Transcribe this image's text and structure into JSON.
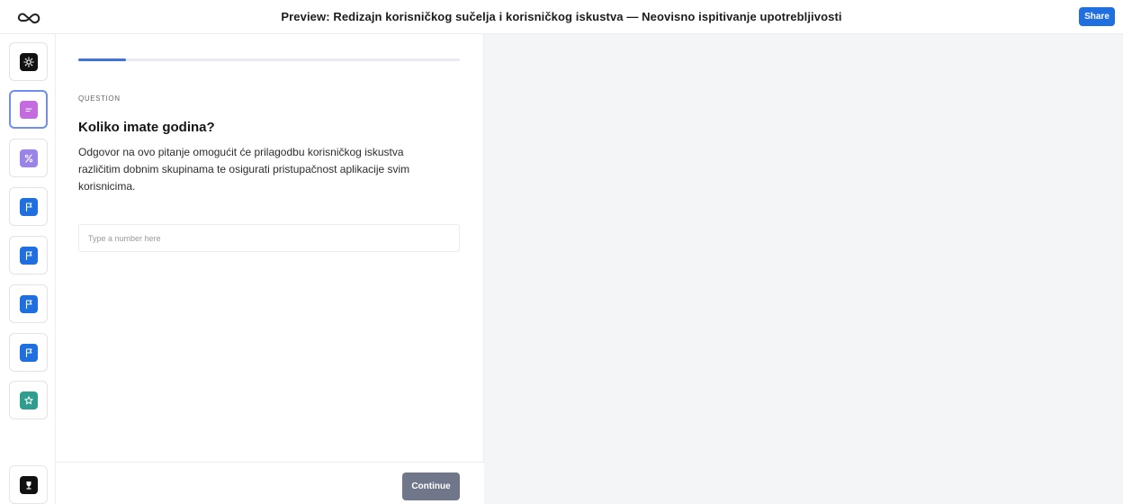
{
  "header": {
    "title": "Preview: Redizajn korisničkog sučelja i korisničkog iskustva — Neovisno ispitivanje upotrebljivosti",
    "share_label": "Share",
    "logo_icon": "infinity-logo-icon"
  },
  "sidebar": {
    "items": [
      {
        "icon": "sun-icon",
        "color": "#111111"
      },
      {
        "icon": "text-lines-icon",
        "color": "#c56be0",
        "selected": true
      },
      {
        "icon": "percent-icon",
        "color": "#9a84e8"
      },
      {
        "icon": "flag-icon",
        "color": "#1f6fe0"
      },
      {
        "icon": "flag-icon",
        "color": "#1f6fe0"
      },
      {
        "icon": "flag-icon",
        "color": "#1f6fe0"
      },
      {
        "icon": "flag-icon",
        "color": "#1f6fe0"
      },
      {
        "icon": "star-icon",
        "color": "#2f9e8f"
      }
    ],
    "bottom_item": {
      "icon": "trophy-icon",
      "color": "#111111"
    }
  },
  "question": {
    "label": "QUESTION",
    "title": "Koliko imate godina?",
    "description": "Odgovor na ovo pitanje omogućit će prilagodbu korisničkog iskustva različitim dobnim skupinama te osigurati pristupačnost aplikacije svim korisnicima.",
    "input_placeholder": "Type a number here",
    "input_value": ""
  },
  "progress": {
    "fraction": 0.125
  },
  "footer": {
    "continue_label": "Continue"
  },
  "colors": {
    "accent": "#1f6fe0",
    "progress": "#3d74d8",
    "continue": "#70778a"
  }
}
